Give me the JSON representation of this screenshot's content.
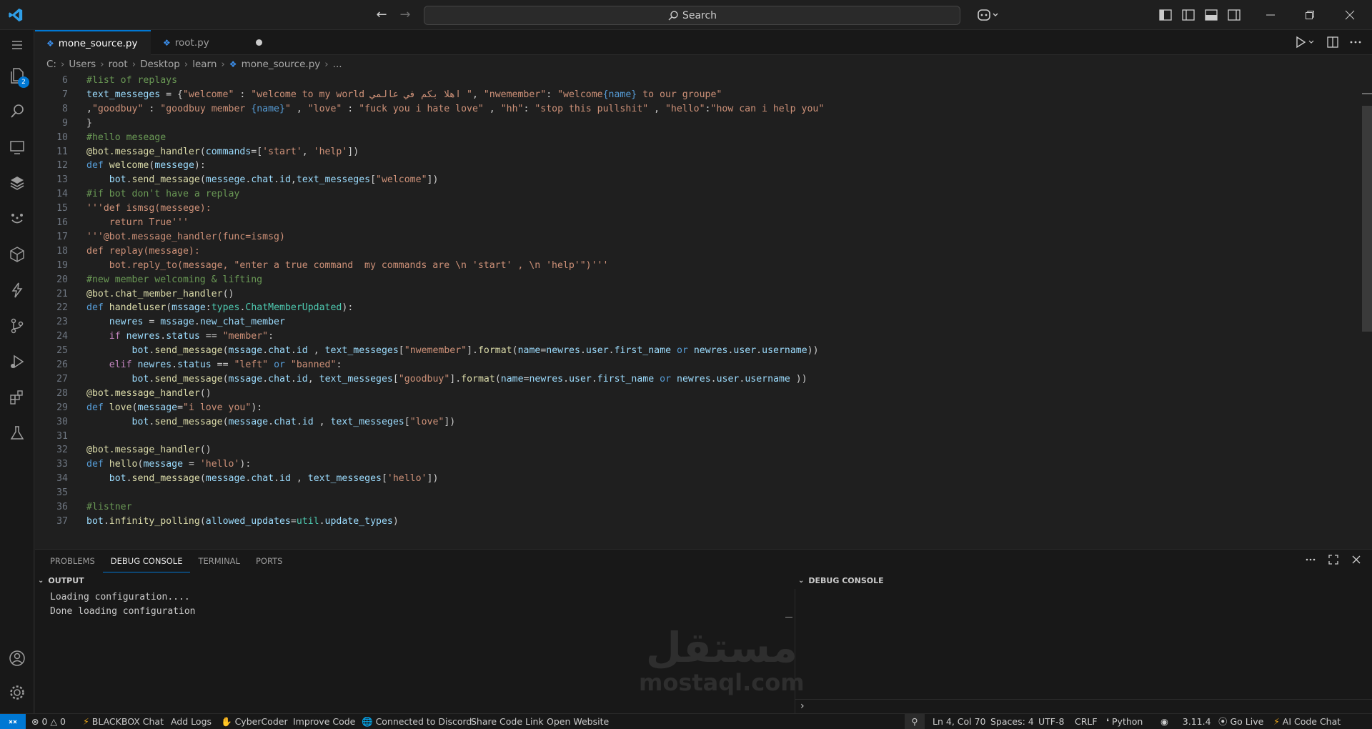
{
  "titlebar": {
    "search_label": "Search"
  },
  "activity": {
    "explorer_badge": "2"
  },
  "tabs": [
    {
      "label": "mone_source.py",
      "active": true
    },
    {
      "label": "root.py",
      "active": false
    }
  ],
  "breadcrumb": [
    "C:",
    "Users",
    "root",
    "Desktop",
    "learn",
    "mone_source.py",
    "..."
  ],
  "editor": {
    "lines": [
      {
        "n": "6",
        "html": "<span class=\"cm\">#list of replays</span>"
      },
      {
        "n": "7",
        "html": "<span class=\"id\">text_messeges</span> = {<span class=\"st\">\"welcome\"</span> : <span class=\"st\">\"welcome to my world اهلا بكم في عالمي \"</span>, <span class=\"st\">\"nwemember\"</span>: <span class=\"st\">\"welcome<span class=\"kw\">{name}</span> to our groupe\"</span>"
      },
      {
        "n": "8",
        "html": ",<span class=\"st\">\"goodbuy\"</span> : <span class=\"st\">\"goodbuy member <span class=\"kw\">{name}</span>\"</span> , <span class=\"st\">\"love\"</span> : <span class=\"st\">\"fuck you i hate love\"</span> , <span class=\"st\">\"hh\"</span>: <span class=\"st\">\"stop this pullshit\"</span> , <span class=\"st\">\"hello\"</span>:<span class=\"st\">\"how can i help you\"</span>"
      },
      {
        "n": "9",
        "html": "}"
      },
      {
        "n": "10",
        "html": "<span class=\"cm\">#hello meseage</span>"
      },
      {
        "n": "11",
        "html": "<span class=\"dec\">@bot.message_handler</span>(<span class=\"id\">commands</span>=[<span class=\"st\">'start'</span>, <span class=\"st\">'help'</span>])"
      },
      {
        "n": "12",
        "html": "<span class=\"kw\">def</span> <span class=\"fn\">welcome</span>(<span class=\"id\">messege</span>):"
      },
      {
        "n": "13",
        "html": "    <span class=\"id\">bot</span>.<span class=\"fn\">send_message</span>(<span class=\"id\">messege</span>.<span class=\"id\">chat</span>.<span class=\"id\">id</span>,<span class=\"id\">text_messeges</span>[<span class=\"st\">\"welcome\"</span>])"
      },
      {
        "n": "14",
        "html": "<span class=\"cm\">#if bot don't have a replay</span>"
      },
      {
        "n": "15",
        "html": "<span class=\"st\">'''def ismsg(messege):</span>"
      },
      {
        "n": "16",
        "html": "<span class=\"st\">    return True'''</span>"
      },
      {
        "n": "17",
        "html": "<span class=\"st\">'''@bot.message_handler(func=ismsg)</span>"
      },
      {
        "n": "18",
        "html": "<span class=\"st\">def replay(message):</span>"
      },
      {
        "n": "19",
        "html": "<span class=\"st\">    bot.reply_to(message, \"enter a true command  my commands are \\n 'start' , \\n 'help'\")'''</span>"
      },
      {
        "n": "20",
        "html": "<span class=\"cm\">#new member welcoming &amp; lifting</span>"
      },
      {
        "n": "21",
        "html": "<span class=\"dec\">@bot.chat_member_handler</span>()"
      },
      {
        "n": "22",
        "html": "<span class=\"kw\">def</span> <span class=\"fn\">handeluser</span>(<span class=\"id\">mssage</span>:<span class=\"ty\">types</span>.<span class=\"ty\">ChatMemberUpdated</span>):"
      },
      {
        "n": "23",
        "html": "    <span class=\"id\">newres</span> = <span class=\"id\">mssage</span>.<span class=\"id\">new_chat_member</span>"
      },
      {
        "n": "24",
        "html": "    <span class=\"pl\">if</span> <span class=\"id\">newres</span>.<span class=\"id\">status</span> == <span class=\"st\">\"member\"</span>:"
      },
      {
        "n": "25",
        "html": "        <span class=\"id\">bot</span>.<span class=\"fn\">send_message</span>(<span class=\"id\">mssage</span>.<span class=\"id\">chat</span>.<span class=\"id\">id</span> , <span class=\"id\">text_messeges</span>[<span class=\"st\">\"nwemember\"</span>].<span class=\"fn\">format</span>(<span class=\"id\">name</span>=<span class=\"id\">newres</span>.<span class=\"id\">user</span>.<span class=\"id\">first_name</span> <span class=\"kw\">or</span> <span class=\"id\">newres</span>.<span class=\"id\">user</span>.<span class=\"id\">username</span>))"
      },
      {
        "n": "26",
        "html": "    <span class=\"pl\">elif</span> <span class=\"id\">newres</span>.<span class=\"id\">status</span> == <span class=\"st\">\"left\"</span> <span class=\"kw\">or</span> <span class=\"st\">\"banned\"</span>:"
      },
      {
        "n": "27",
        "html": "        <span class=\"id\">bot</span>.<span class=\"fn\">send_message</span>(<span class=\"id\">mssage</span>.<span class=\"id\">chat</span>.<span class=\"id\">id</span>, <span class=\"id\">text_messeges</span>[<span class=\"st\">\"goodbuy\"</span>].<span class=\"fn\">format</span>(<span class=\"id\">name</span>=<span class=\"id\">newres</span>.<span class=\"id\">user</span>.<span class=\"id\">first_name</span> <span class=\"kw\">or</span> <span class=\"id\">newres</span>.<span class=\"id\">user</span>.<span class=\"id\">username</span> ))"
      },
      {
        "n": "28",
        "html": "<span class=\"dec\">@bot.message_handler</span>()"
      },
      {
        "n": "29",
        "html": "<span class=\"kw\">def</span> <span class=\"fn\">love</span>(<span class=\"id\">message</span>=<span class=\"st\">\"i love you\"</span>):"
      },
      {
        "n": "30",
        "html": "        <span class=\"id\">bot</span>.<span class=\"fn\">send_message</span>(<span class=\"id\">message</span>.<span class=\"id\">chat</span>.<span class=\"id\">id</span> , <span class=\"id\">text_messeges</span>[<span class=\"st\">\"love\"</span>])"
      },
      {
        "n": "31",
        "html": ""
      },
      {
        "n": "32",
        "html": "<span class=\"dec\">@bot.message_handler</span>()"
      },
      {
        "n": "33",
        "html": "<span class=\"kw\">def</span> <span class=\"fn\">hello</span>(<span class=\"id\">message</span> = <span class=\"st\">'hello'</span>):"
      },
      {
        "n": "34",
        "html": "    <span class=\"id\">bot</span>.<span class=\"fn\">send_message</span>(<span class=\"id\">message</span>.<span class=\"id\">chat</span>.<span class=\"id\">id</span> , <span class=\"id\">text_messeges</span>[<span class=\"st\">'hello'</span>])"
      },
      {
        "n": "35",
        "html": ""
      },
      {
        "n": "36",
        "html": "<span class=\"cm\">#listner</span>"
      },
      {
        "n": "37",
        "html": "<span class=\"id\">bot</span>.<span class=\"fn\">infinity_polling</span>(<span class=\"id\">allowed_updates</span>=<span class=\"ty\">util</span>.<span class=\"id\">update_types</span>)"
      }
    ]
  },
  "panel": {
    "tabs": [
      "PROBLEMS",
      "DEBUG CONSOLE",
      "TERMINAL",
      "PORTS"
    ],
    "active_tab": "DEBUG CONSOLE",
    "output_title": "OUTPUT",
    "debug_title": "DEBUG CONSOLE",
    "output_lines": "Loading configuration....\nDone loading configuration",
    "watermark_ar": "مستقل",
    "watermark_lat": "mostaql.com"
  },
  "statusbar": {
    "errors": "0",
    "warnings": "0",
    "blackbox": "BLACKBOX Chat",
    "add_logs": "Add Logs",
    "cybercoder": "CyberCoder",
    "improve": "Improve Code",
    "discord": "Connected to Discord",
    "share": "Share Code Link",
    "open_website": "Open Website",
    "position": "Ln 4, Col 70",
    "spaces": "Spaces: 4",
    "encoding": "UTF-8",
    "eol": "CRLF",
    "language": "Python",
    "version": "3.11.4",
    "golive": "Go Live",
    "ai_chat": "AI Code Chat"
  },
  "colors": {
    "accent": "#0078d4",
    "editor_bg": "#1f1f1f"
  }
}
